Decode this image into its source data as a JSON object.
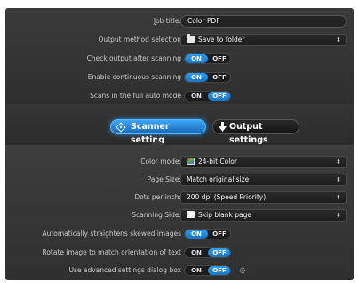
{
  "output": {
    "job_title_label": "Job title:",
    "job_title_value": "Color PDF",
    "method_label": "Output method selection",
    "method_value": "Save to folder",
    "check_label": "Check output after scanning",
    "check_state": "on",
    "continuous_label": "Enable continuous scanning",
    "continuous_state": "on",
    "auto_mode_label": "Scans in the full auto mode",
    "auto_mode_state": "off"
  },
  "toggle": {
    "on": "ON",
    "off": "OFF"
  },
  "tabs": {
    "scanner_label": "Scanner setting",
    "output_label": "Output settings",
    "active": "scanner"
  },
  "scanner": {
    "color_mode_label": "Color mode:",
    "color_mode_value": "24-bit Color",
    "page_size_label": "Page Size:",
    "page_size_value": "Match original size",
    "dpi_label": "Dots per inch:",
    "dpi_value": "200 dpi (Speed Priority)",
    "side_label": "Scanning Side:",
    "side_value": "Skip blank page",
    "straighten_label": "Automatically straightens skewed images",
    "straighten_state": "on",
    "rotate_label": "Rotate image to match orientation of text",
    "rotate_state": "off",
    "advanced_label": "Use advanced settings dialog box",
    "advanced_state": "off"
  },
  "colors": {
    "accent": "#1f86dd",
    "panel": "#363636",
    "field": "#1f1f1f"
  },
  "icons": {
    "method": "folder-icon",
    "color_mode": "color-icon",
    "side": "page-icon",
    "scanner_tab": "diamond-icon",
    "output_tab": "down-arrow-icon",
    "advanced": "gear-icon"
  }
}
